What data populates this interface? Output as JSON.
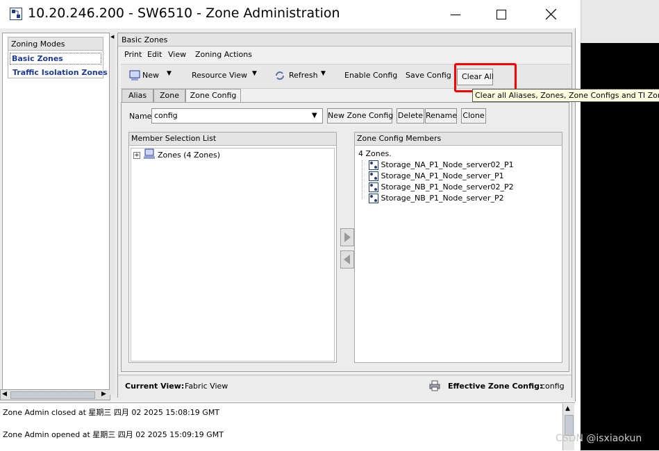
{
  "window": {
    "title": "10.20.246.200 - SW6510 - Zone Administration",
    "minimize_glyph": "—",
    "maximize_glyph": "☐",
    "close_glyph": "✕"
  },
  "left_panel": {
    "title": "Zoning Modes",
    "items": [
      {
        "label": "Basic Zones",
        "selected": true
      },
      {
        "label": "Traffic Isolation Zones",
        "selected": false
      }
    ]
  },
  "main": {
    "header": "Basic Zones",
    "menu": [
      "Print",
      "Edit",
      "View",
      "Zoning Actions"
    ],
    "toolbar": {
      "new_label": "New",
      "resource_view_label": "Resource View",
      "refresh_label": "Refresh",
      "enable_config_label": "Enable Config",
      "save_config_label": "Save Config",
      "clear_all_label": "Clear All"
    },
    "tooltip": "Clear all Aliases, Zones, Zone Configs and TI Zones",
    "tabs": [
      {
        "label": "Alias",
        "active": false
      },
      {
        "label": "Zone",
        "active": false
      },
      {
        "label": "Zone Config",
        "active": true
      }
    ],
    "name_label": "Name",
    "name_value": "config",
    "buttons": {
      "new_zone_config": "New Zone Config",
      "delete": "Delete",
      "rename": "Rename",
      "clone": "Clone"
    },
    "member_selection": {
      "title": "Member Selection List",
      "tree_root": "Zones (4 Zones)",
      "expander": "+"
    },
    "zone_config_members": {
      "title": "Zone Config Members",
      "count": "4 Zones.",
      "items": [
        "Storage_NA_P1_Node_server02_P1",
        "Storage_NA_P1_Node_server_P1",
        "Storage_NB_P1_Node_server02_P2",
        "Storage_NB_P1_Node_server_P2"
      ]
    },
    "status": {
      "current_view_label": "Current View:",
      "current_view_value": "Fabric View",
      "effective_label": "Effective Zone Config:",
      "effective_value": "config"
    }
  },
  "log": [
    "Zone Admin closed at 星期三 四月 02 2025 15:08:19 GMT",
    "Zone Admin opened at 星期三 四月 02 2025 15:09:19 GMT"
  ],
  "watermark": "CSDN @isxiaokun",
  "colors": {
    "highlight": "#ff0000",
    "link_blue": "#1f3a93",
    "tooltip_bg": "#ffffe1"
  }
}
